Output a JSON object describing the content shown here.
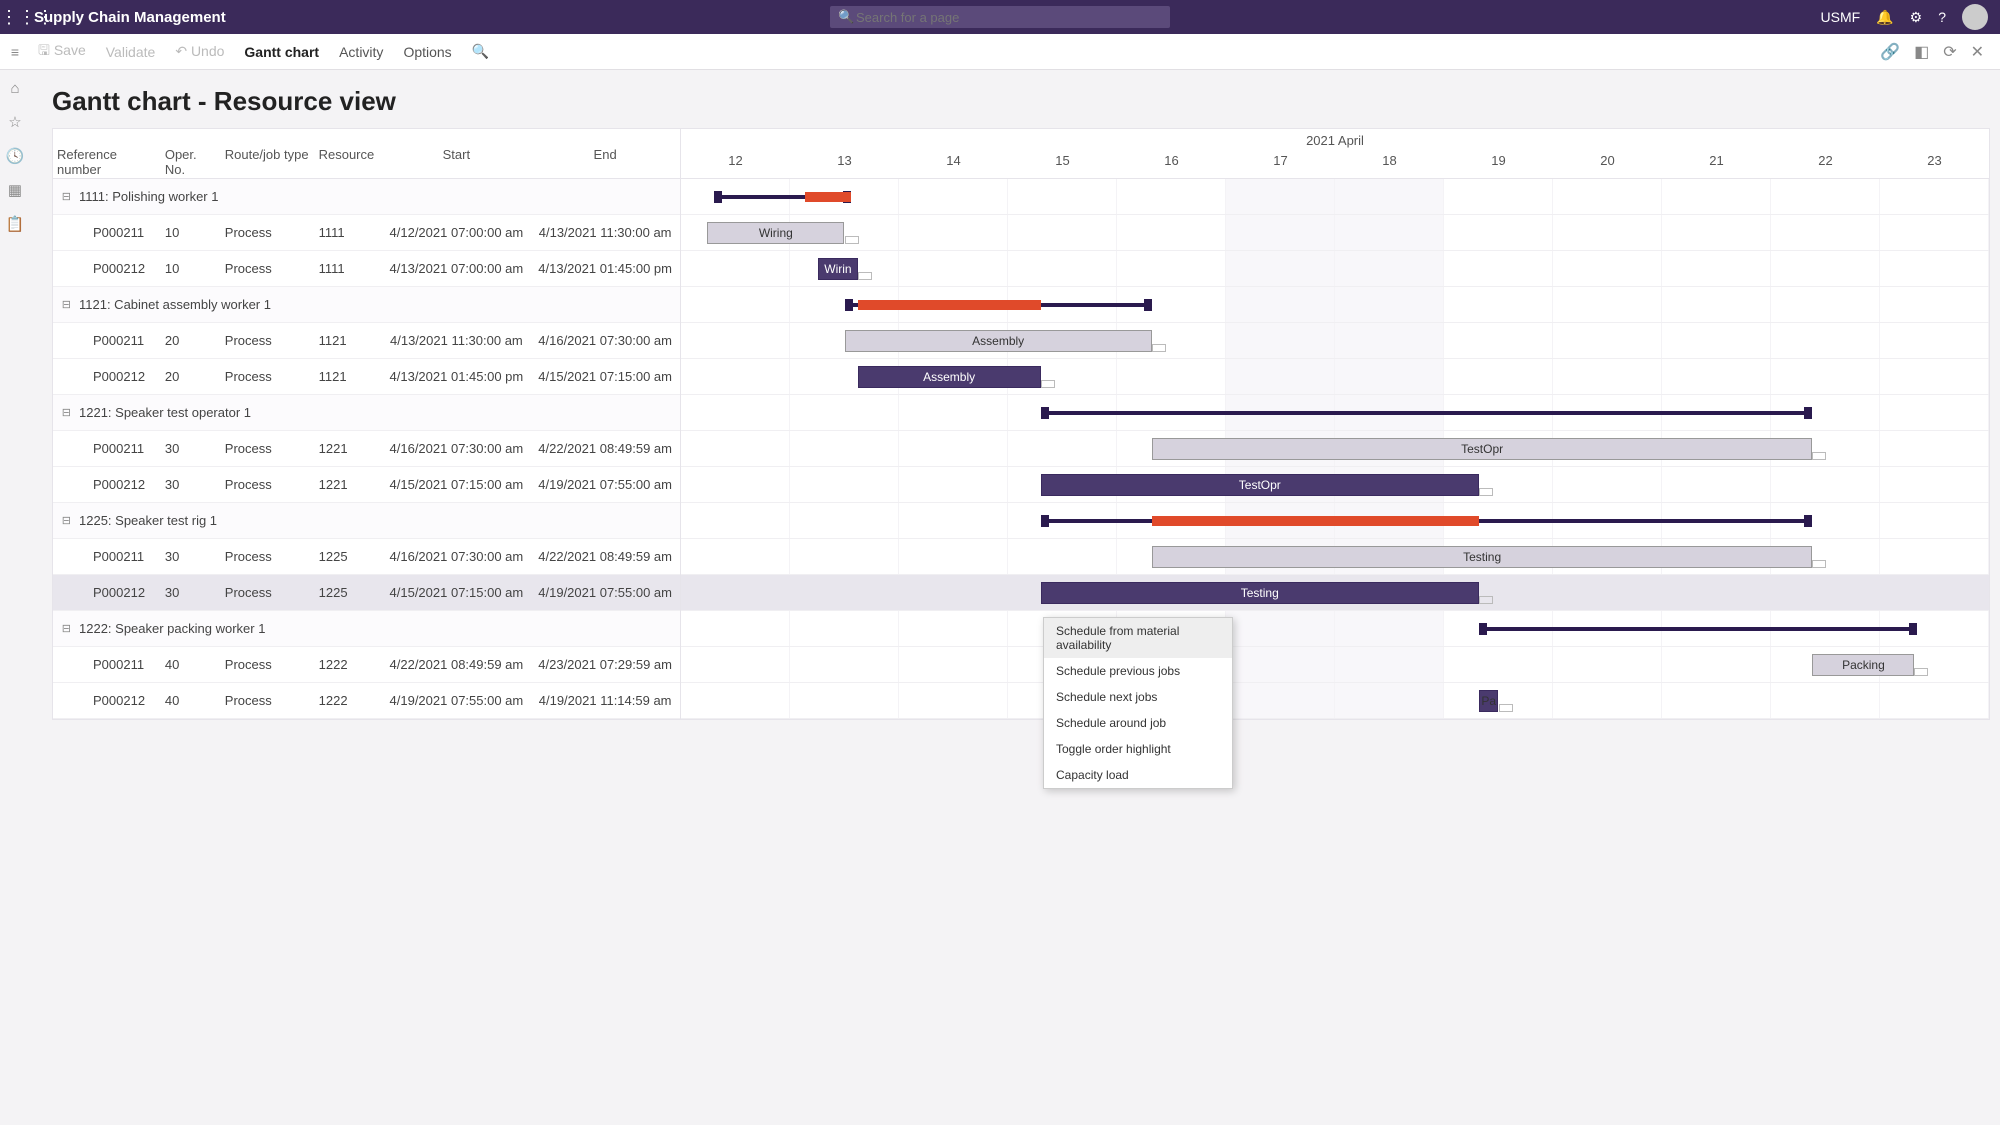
{
  "topbar": {
    "app_title": "Supply Chain Management",
    "search_placeholder": "Search for a page",
    "company": "USMF"
  },
  "actionbar": {
    "save": "Save",
    "validate": "Validate",
    "undo": "Undo",
    "gantt": "Gantt chart",
    "activity": "Activity",
    "options": "Options"
  },
  "page_title": "Gantt chart - Resource view",
  "columns": {
    "ref": "Reference number",
    "oper": "Oper. No.",
    "type": "Route/job type",
    "res": "Resource",
    "start": "Start",
    "end": "End"
  },
  "timeline": {
    "month_label": "2021 April",
    "days": [
      "12",
      "13",
      "14",
      "15",
      "16",
      "17",
      "18",
      "19",
      "20",
      "21",
      "22",
      "23"
    ]
  },
  "groups": [
    {
      "label": "1111: Polishing worker 1",
      "rows": [
        {
          "ref": "P000211",
          "oper": "10",
          "type": "Process",
          "res": "1111",
          "start": "4/12/2021 07:00:00 am",
          "end": "4/13/2021 11:30:00 am",
          "bar": {
            "style": "light",
            "label": "Wiring",
            "from": 0.02,
            "to": 0.125
          }
        },
        {
          "ref": "P000212",
          "oper": "10",
          "type": "Process",
          "res": "1111",
          "start": "4/13/2021 07:00:00 am",
          "end": "4/13/2021 01:45:00 pm",
          "bar": {
            "style": "dark",
            "label": "Wirin",
            "from": 0.105,
            "to": 0.135
          }
        }
      ],
      "summary": {
        "from": 0.025,
        "to": 0.13,
        "red": [
          {
            "from": 0.095,
            "to": 0.13
          }
        ]
      }
    },
    {
      "label": "1121: Cabinet assembly worker 1",
      "rows": [
        {
          "ref": "P000211",
          "oper": "20",
          "type": "Process",
          "res": "1121",
          "start": "4/13/2021 11:30:00 am",
          "end": "4/16/2021 07:30:00 am",
          "bar": {
            "style": "light",
            "label": "Assembly",
            "from": 0.125,
            "to": 0.36
          }
        },
        {
          "ref": "P000212",
          "oper": "20",
          "type": "Process",
          "res": "1121",
          "start": "4/13/2021 01:45:00 pm",
          "end": "4/15/2021 07:15:00 am",
          "bar": {
            "style": "dark",
            "label": "Assembly",
            "from": 0.135,
            "to": 0.275
          }
        }
      ],
      "summary": {
        "from": 0.125,
        "to": 0.36,
        "red": [
          {
            "from": 0.135,
            "to": 0.275
          }
        ]
      }
    },
    {
      "label": "1221: Speaker test operator 1",
      "rows": [
        {
          "ref": "P000211",
          "oper": "30",
          "type": "Process",
          "res": "1221",
          "start": "4/16/2021 07:30:00 am",
          "end": "4/22/2021 08:49:59 am",
          "bar": {
            "style": "light",
            "label": "TestOpr",
            "from": 0.36,
            "to": 0.865
          }
        },
        {
          "ref": "P000212",
          "oper": "30",
          "type": "Process",
          "res": "1221",
          "start": "4/15/2021 07:15:00 am",
          "end": "4/19/2021 07:55:00 am",
          "bar": {
            "style": "dark",
            "label": "TestOpr",
            "from": 0.275,
            "to": 0.61
          }
        }
      ],
      "summary": {
        "from": 0.275,
        "to": 0.865,
        "red": []
      }
    },
    {
      "label": "1225: Speaker test rig 1",
      "rows": [
        {
          "ref": "P000211",
          "oper": "30",
          "type": "Process",
          "res": "1225",
          "start": "4/16/2021 07:30:00 am",
          "end": "4/22/2021 08:49:59 am",
          "bar": {
            "style": "light",
            "label": "Testing",
            "from": 0.36,
            "to": 0.865
          }
        },
        {
          "ref": "P000212",
          "oper": "30",
          "type": "Process",
          "res": "1225",
          "start": "4/15/2021 07:15:00 am",
          "end": "4/19/2021 07:55:00 am",
          "bar": {
            "style": "dark",
            "label": "Testing",
            "from": 0.275,
            "to": 0.61
          },
          "selected": true
        }
      ],
      "summary": {
        "from": 0.275,
        "to": 0.865,
        "red": [
          {
            "from": 0.36,
            "to": 0.61
          }
        ]
      }
    },
    {
      "label": "1222: Speaker packing worker 1",
      "rows": [
        {
          "ref": "P000211",
          "oper": "40",
          "type": "Process",
          "res": "1222",
          "start": "4/22/2021 08:49:59 am",
          "end": "4/23/2021 07:29:59 am",
          "bar": {
            "style": "light",
            "label": "Packing",
            "from": 0.865,
            "to": 0.943
          }
        },
        {
          "ref": "P000212",
          "oper": "40",
          "type": "Process",
          "res": "1222",
          "start": "4/19/2021 07:55:00 am",
          "end": "4/19/2021 11:14:59 am",
          "bar": {
            "style": "small-dark",
            "label": "Pa",
            "from": 0.61,
            "to": 0.625
          }
        }
      ],
      "summary": {
        "from": 0.61,
        "to": 0.945,
        "red": []
      }
    }
  ],
  "context_menu": {
    "items": [
      "Schedule from material availability",
      "Schedule previous jobs",
      "Schedule next jobs",
      "Schedule around job",
      "Toggle order highlight",
      "Capacity load"
    ]
  }
}
